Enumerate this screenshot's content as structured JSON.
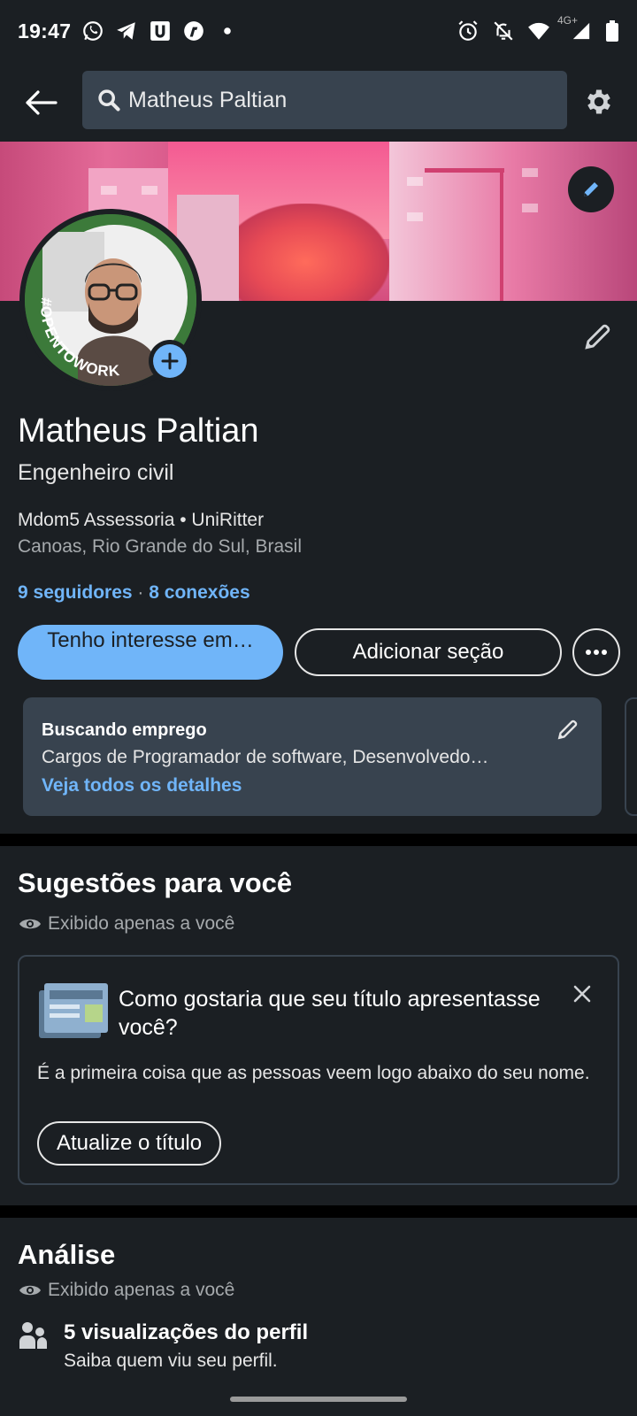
{
  "status_bar": {
    "time": "19:47",
    "network_type": "4G+",
    "left_icons": [
      "whatsapp-icon",
      "telegram-icon",
      "u-app-icon",
      "r-app-icon",
      "notification-dot-icon"
    ],
    "right_icons": [
      "alarm-icon",
      "notifications-off-icon",
      "wifi-icon",
      "signal-icon",
      "battery-icon"
    ]
  },
  "top_bar": {
    "search_value": "Matheus Paltian",
    "icons": [
      "back-arrow-icon",
      "search-icon",
      "gear-icon"
    ]
  },
  "profile": {
    "name": "Matheus Paltian",
    "headline": "Engenheiro civil",
    "company_line": "Mdom5 Assessoria • UniRitter",
    "location": "Canoas, Rio Grande do Sul, Brasil",
    "followers": "9 seguidores",
    "separator": "·",
    "connections": "8 conexões",
    "open_to_work_frame_text": "#OPENTOWORK"
  },
  "actions": {
    "primary": "Tenho interesse em…",
    "secondary": "Adicionar seção"
  },
  "open_to_work_card": {
    "title": "Buscando emprego",
    "description": "Cargos de Programador de software, Desenvolvedo…",
    "link": "Veja todos os detalhes"
  },
  "suggestions": {
    "title": "Sugestões para você",
    "visibility": "Exibido apenas a você",
    "card": {
      "question": "Como gostaria que seu título apresentasse você?",
      "explanation": "É a primeira coisa que as pessoas veem logo abaixo do seu nome.",
      "cta": "Atualize o título"
    }
  },
  "analytics": {
    "title": "Análise",
    "visibility": "Exibido apenas a você",
    "item_title": "5 visualizações do perfil",
    "item_subtitle": "Saiba quem viu seu perfil."
  },
  "colors": {
    "background": "#1b1f23",
    "accent": "#70b5f9",
    "card": "#38434f",
    "open_to_work_green": "#3a7a3a"
  }
}
